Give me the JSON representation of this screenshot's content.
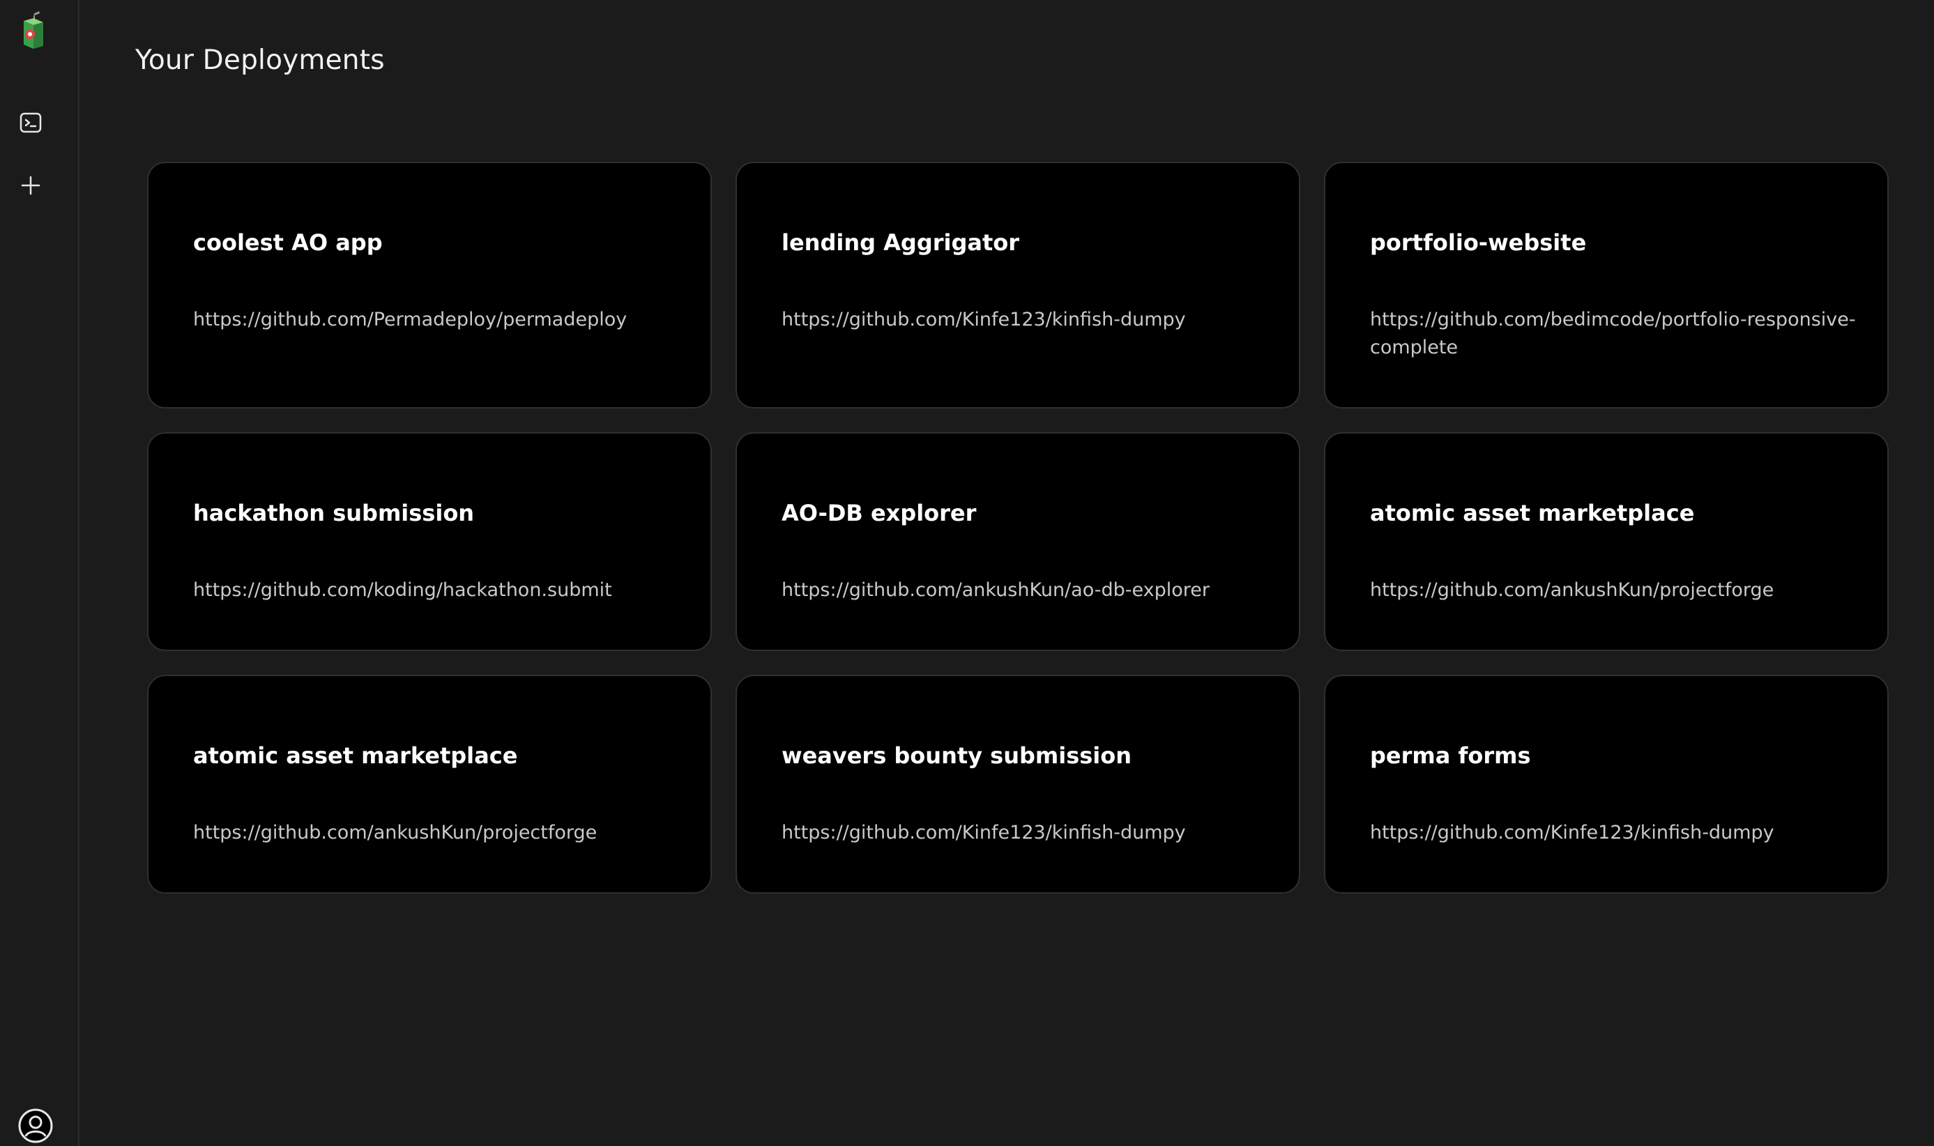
{
  "page": {
    "title": "Your Deployments"
  },
  "sidebar": {
    "logo_icon": "juice-box-logo-icon",
    "items": [
      {
        "name": "terminal-icon"
      },
      {
        "name": "plus-icon"
      }
    ],
    "profile_icon": "user-circle-icon"
  },
  "deployments": [
    {
      "name": "coolest AO app",
      "repo": "https://github.com/Permadeploy/permadeploy"
    },
    {
      "name": "lending Aggrigator",
      "repo": "https://github.com/Kinfe123/kinfish-dumpy"
    },
    {
      "name": "portfolio-website",
      "repo": "https://github.com/bedimcode/portfolio-responsive-complete"
    },
    {
      "name": "hackathon submission",
      "repo": "https://github.com/koding/hackathon.submit"
    },
    {
      "name": "AO-DB explorer",
      "repo": "https://github.com/ankushKun/ao-db-explorer"
    },
    {
      "name": "atomic asset marketplace",
      "repo": "https://github.com/ankushKun/projectforge"
    },
    {
      "name": "atomic asset marketplace",
      "repo": "https://github.com/ankushKun/projectforge"
    },
    {
      "name": "weavers bounty submission",
      "repo": "https://github.com/Kinfe123/kinfish-dumpy"
    },
    {
      "name": "perma forms",
      "repo": "https://github.com/Kinfe123/kinfish-dumpy"
    }
  ],
  "colors": {
    "background": "#1b1b1b",
    "card": "#000000",
    "card_border": "#2f2f2f",
    "title_text": "#ffffff",
    "url_text": "#c9c9c9"
  }
}
